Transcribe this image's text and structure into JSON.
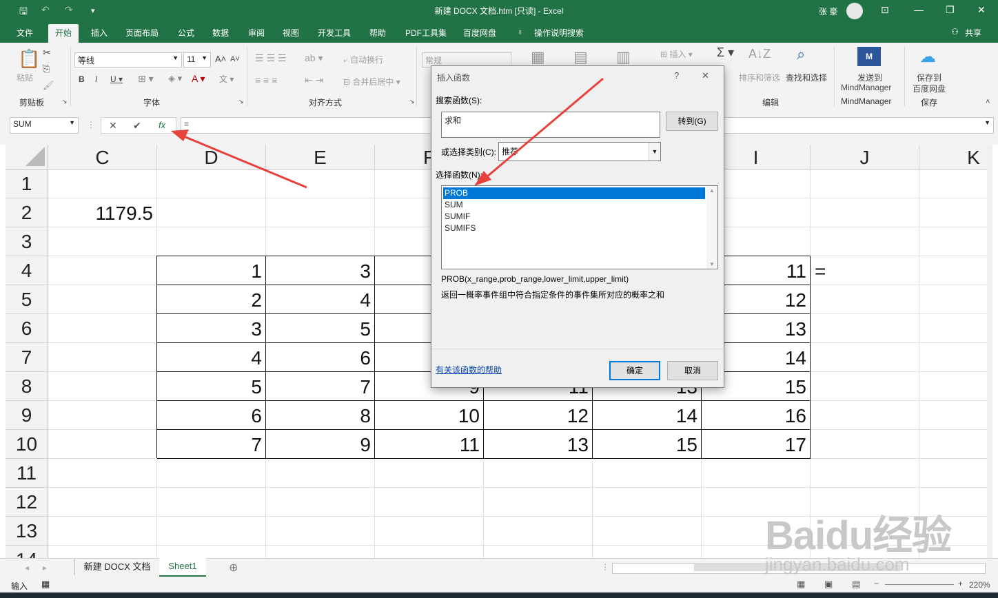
{
  "window": {
    "title": "新建 DOCX 文档.htm  [只读]  -  Excel",
    "user": "张 豪"
  },
  "tabs": [
    "文件",
    "开始",
    "插入",
    "页面布局",
    "公式",
    "数据",
    "审阅",
    "视图",
    "开发工具",
    "帮助",
    "PDF工具集",
    "百度网盘"
  ],
  "tell_me": "操作说明搜索",
  "share": "共享",
  "ribbon": {
    "paste": "粘贴",
    "clipboard": "剪贴板",
    "font_name": "等线",
    "font_size": "11",
    "font_group": "字体",
    "wrap": "自动换行",
    "merge": "合并后居中",
    "align_group": "对齐方式",
    "number_format": "常规",
    "insert": "插入",
    "sort": "排序和筛选",
    "find": "查找和选择",
    "edit_group": "编辑",
    "send": "发送到",
    "mindmanager": "MindManager",
    "mm_group": "MindManager",
    "save_cloud": "保存到",
    "cloud": "百度网盘",
    "save_group": "保存"
  },
  "formula_bar": {
    "name_box": "SUM",
    "formula": "="
  },
  "columns": [
    "C",
    "D",
    "E",
    "F",
    "G",
    "H",
    "I",
    "J",
    "K"
  ],
  "rows": [
    "1",
    "2",
    "3",
    "4",
    "5",
    "6",
    "7",
    "8",
    "9",
    "10",
    "11",
    "12",
    "13",
    "14"
  ],
  "cells": {
    "c2": "1179.5",
    "j4": "=",
    "d": [
      "1",
      "2",
      "3",
      "4",
      "5",
      "6",
      "7"
    ],
    "e": [
      "3",
      "4",
      "5",
      "6",
      "7",
      "8",
      "9"
    ],
    "f_visible": [
      "9",
      "10",
      "11"
    ],
    "g_visible": [
      "11",
      "12",
      "13"
    ],
    "h_visible": [
      "13",
      "14",
      "15"
    ],
    "i": [
      "11",
      "12",
      "13",
      "14",
      "15",
      "16",
      "17"
    ]
  },
  "sheets": [
    "新建 DOCX 文档",
    "Sheet1"
  ],
  "status": {
    "mode": "输入",
    "zoom": "220%"
  },
  "dialog": {
    "title": "插入函数",
    "search_label": "搜索函数(S):",
    "search_value": "求和",
    "go_button": "转到(G)",
    "category_label": "或选择类别(C):",
    "category_value": "推荐",
    "select_label": "选择函数(N):",
    "functions": [
      "PROB",
      "SUM",
      "SUMIF",
      "SUMIFS"
    ],
    "signature": "PROB(x_range,prob_range,lower_limit,upper_limit)",
    "description": "返回一概率事件组中符合指定条件的事件集所对应的概率之和",
    "help_link": "有关该函数的帮助",
    "ok": "确定",
    "cancel": "取消",
    "help_button": "?",
    "close_button": "✕"
  },
  "watermark": {
    "brand": "Baidu经验",
    "url": "jingyan.baidu.com"
  },
  "colors": {
    "excel_green": "#217346",
    "selection": "#0078d7",
    "arrow": "#e8403a"
  }
}
